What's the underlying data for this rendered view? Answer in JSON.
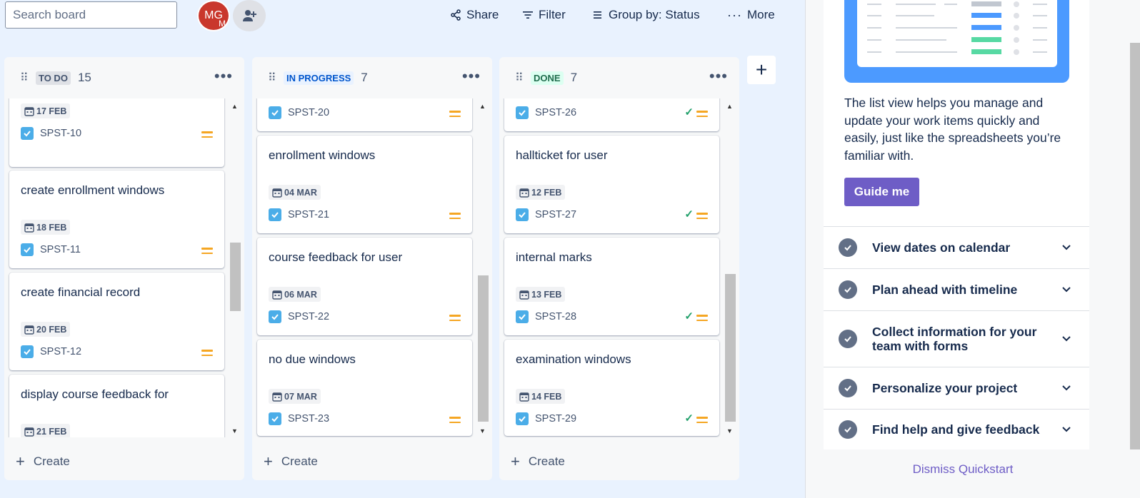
{
  "search": {
    "placeholder": "Search board",
    "icon": "search-icon"
  },
  "avatar": {
    "initials": "MG",
    "sub": "M",
    "color": "#c9372c"
  },
  "toolbar": {
    "share": "Share",
    "filter": "Filter",
    "group_by": "Group by: Status",
    "more": "More"
  },
  "columns": [
    {
      "name": "TO DO",
      "count": "15",
      "cards": [
        {
          "title": "",
          "date": "17 FEB",
          "key": "SPST-10"
        },
        {
          "title": "create enrollment windows",
          "date": "18 FEB",
          "key": "SPST-11"
        },
        {
          "title": "create financial record",
          "date": "20 FEB",
          "key": "SPST-12"
        },
        {
          "title": "display course feedback for",
          "date": "21 FEB",
          "key": ""
        }
      ],
      "create": "Create"
    },
    {
      "name": "IN PROGRESS",
      "count": "7",
      "cards": [
        {
          "title": "",
          "date": "",
          "key": "SPST-20"
        },
        {
          "title": "enrollment windows",
          "date": "04 MAR",
          "key": "SPST-21"
        },
        {
          "title": "course feedback for user",
          "date": "06 MAR",
          "key": "SPST-22"
        },
        {
          "title": "no due windows",
          "date": "07 MAR",
          "key": "SPST-23"
        }
      ],
      "create": "Create"
    },
    {
      "name": "DONE",
      "count": "7",
      "cards": [
        {
          "title": "",
          "date": "",
          "key": "SPST-26"
        },
        {
          "title": "hallticket for user",
          "date": "12 FEB",
          "key": "SPST-27"
        },
        {
          "title": "internal marks",
          "date": "13 FEB",
          "key": "SPST-28"
        },
        {
          "title": "examination windows",
          "date": "14 FEB",
          "key": "SPST-29"
        }
      ],
      "create": "Create"
    }
  ],
  "quickstart": {
    "description": "The list view helps you manage and update your work items quickly and easily, just like the spreadsheets you’re familiar with.",
    "guide_button": "Guide me",
    "items": [
      "View dates on calendar",
      "Plan ahead with timeline",
      "Collect information for your team with forms",
      "Personalize your project",
      "Find help and give feedback"
    ],
    "dismiss": "Dismiss Quickstart"
  },
  "colors": {
    "background": "#e9f2fe",
    "priority": "#f5a623",
    "done": "#22a06b",
    "guide": "#6e5dc6"
  }
}
